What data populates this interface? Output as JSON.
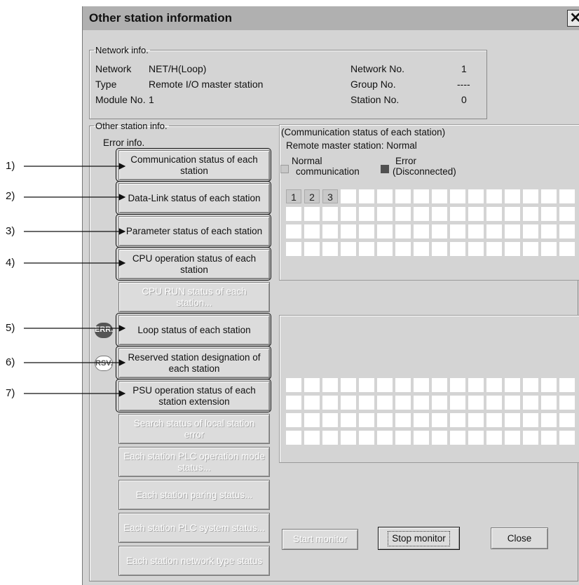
{
  "window": {
    "title": "Other station information",
    "close_glyph": "✕"
  },
  "network_info": {
    "legend": "Network info.",
    "network_label": "Network",
    "network_value": "NET/H(Loop)",
    "type_label": "Type",
    "type_value": "Remote I/O master station",
    "module_label": "Module No.",
    "module_value": "1",
    "network_no_label": "Network No.",
    "network_no_value": "1",
    "group_no_label": "Group No.",
    "group_no_value": "----",
    "station_no_label": "Station No.",
    "station_no_value": "0"
  },
  "other_station": {
    "legend": "Other station info.",
    "error_info_label": "Error info.",
    "buttons": [
      {
        "label": "Communication status of each station",
        "enabled": true
      },
      {
        "label": "Data-Link status of each station",
        "enabled": true
      },
      {
        "label": "Parameter status of each station",
        "enabled": true
      },
      {
        "label": "CPU operation status of each station",
        "enabled": true
      },
      {
        "label": "CPU RUN status of each station...",
        "enabled": false
      },
      {
        "label": "Loop status of each station",
        "enabled": true
      },
      {
        "label": "Reserved station designation of each station",
        "enabled": true
      },
      {
        "label": "PSU operation status of each station extension",
        "enabled": true
      },
      {
        "label": "Search status of local station error",
        "enabled": false
      },
      {
        "label": "Each station PLC operation mode status...",
        "enabled": false
      },
      {
        "label": "Each station paring status...",
        "enabled": false
      },
      {
        "label": "Each station PLC system status...",
        "enabled": false
      },
      {
        "label": "Each station network type status",
        "enabled": false
      }
    ],
    "badges": {
      "err": "ERR.",
      "rsv": "RSV."
    }
  },
  "status_panel": {
    "heading": "(Communication status of each station)",
    "remote_master": "Remote master station: Normal",
    "legend_normal_line1": "Normal",
    "legend_normal_line2": "communication",
    "legend_error_line1": "Error",
    "legend_error_line2": "(Disconnected)",
    "stations": [
      "1",
      "2",
      "3"
    ],
    "colors": {
      "normal": "#c8c8c8",
      "error": "#505050"
    }
  },
  "footer": {
    "start_monitor": "Start monitor",
    "stop_monitor": "Stop monitor",
    "close": "Close"
  },
  "callouts": [
    "1)",
    "2)",
    "3)",
    "4)",
    "5)",
    "6)",
    "7)"
  ]
}
